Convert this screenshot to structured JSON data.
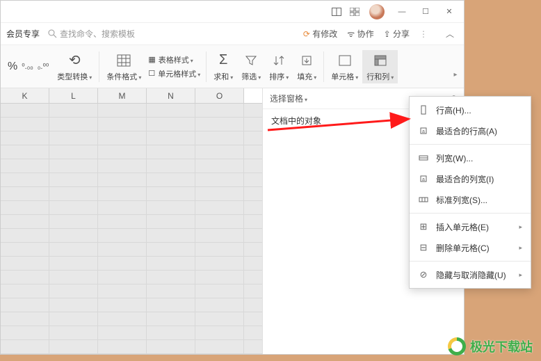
{
  "titlebar": {
    "layout_icon1": "⬚",
    "layout_icon2": "⊞"
  },
  "menubar": {
    "member": "会员专享",
    "search_placeholder": "查找命令、搜索模板",
    "has_changes": "有修改",
    "collab": "协作",
    "share": "分享"
  },
  "toolbar": {
    "percent": "%",
    "dec_inc": "⁰₀₀",
    "dec_dec": "⁰₀₀",
    "type_convert": "类型转换",
    "cond_format": "条件格式",
    "table_style": "表格样式",
    "cell_style": "单元格样式",
    "sum": "求和",
    "filter": "筛选",
    "sort": "排序",
    "fill": "填充",
    "cell": "单元格",
    "row_col": "行和列"
  },
  "side": {
    "pane": "选择窗格",
    "objects": "文档中的对象"
  },
  "dropdown": {
    "row_height": "行高(H)...",
    "fit_row": "最适合的行高(A)",
    "col_width": "列宽(W)...",
    "fit_col": "最适合的列宽(I)",
    "std_width": "标准列宽(S)...",
    "insert_cell": "插入单元格(E)",
    "delete_cell": "删除单元格(C)",
    "hide": "隐藏与取消隐藏(U)"
  },
  "columns": [
    "K",
    "L",
    "M",
    "N",
    "O"
  ],
  "watermark": "极光下载站"
}
